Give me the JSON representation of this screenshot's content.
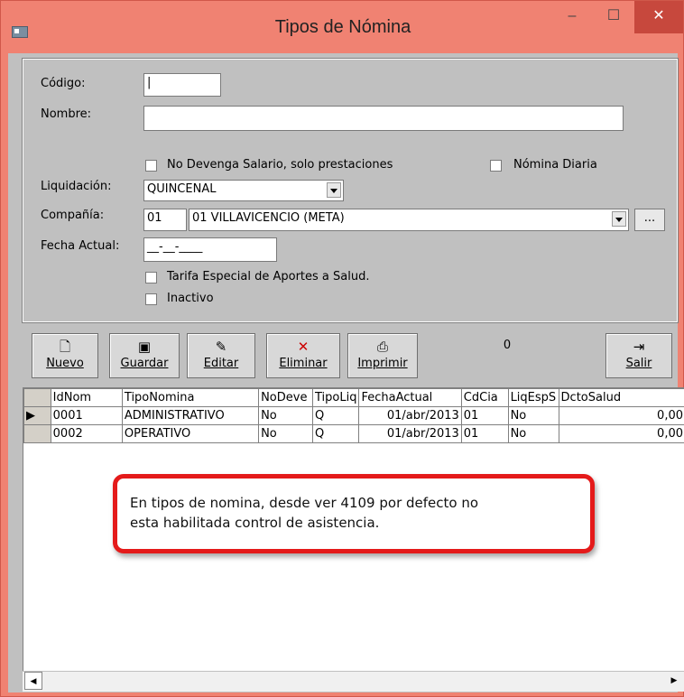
{
  "window": {
    "title": "Tipos de Nómina",
    "min_glyph": "–",
    "max_glyph": "☐",
    "close_glyph": "✕"
  },
  "form": {
    "codigo_label": "Código:",
    "codigo_value": "|",
    "nombre_label": "Nombre:",
    "nombre_value": "",
    "no_devenga_label": "No Devenga Salario, solo prestaciones",
    "nomina_diaria_label": "Nómina Diaria",
    "liquidacion_label": "Liquidación:",
    "liquidacion_value": "QUINCENAL",
    "compania_label": "Compañía:",
    "compania_code": "01",
    "compania_value": "01  VILLAVICENCIO (META)",
    "browse_label": "...",
    "fecha_label": "Fecha Actual:",
    "fecha_value": "__-__-____",
    "tarifa_label": "Tarifa Especial de Aportes a Salud.",
    "inactivo_label": "Inactivo"
  },
  "toolbar": {
    "nuevo": "Nuevo",
    "guardar": "Guardar",
    "editar": "Editar",
    "eliminar": "Eliminar",
    "imprimir": "Imprimir",
    "salir": "Salir",
    "record_number": "0"
  },
  "grid": {
    "columns": [
      "IdNom",
      "TipoNomina",
      "NoDeve",
      "TipoLiq",
      "FechaActual",
      "CdCia",
      "LiqEspS",
      "DctoSalud"
    ],
    "rows": [
      [
        "0001",
        "ADMINISTRATIVO",
        "No",
        "Q",
        "01/abr/2013",
        "01",
        "No",
        "0,00"
      ],
      [
        "0002",
        "OPERATIVO",
        "No",
        "Q",
        "01/abr/2013",
        "01",
        "No",
        "0,00"
      ]
    ],
    "current_row_marker": "▶"
  },
  "callout": {
    "line1": "En tipos de nomina, desde ver 4109 por defecto no",
    "line2": "esta habilitada control de asistencia."
  },
  "colors": {
    "title_bar": "#f08272",
    "close_button": "#c7483d",
    "callout_border": "#e41a1a",
    "client_bg": "#c0c0c0"
  }
}
